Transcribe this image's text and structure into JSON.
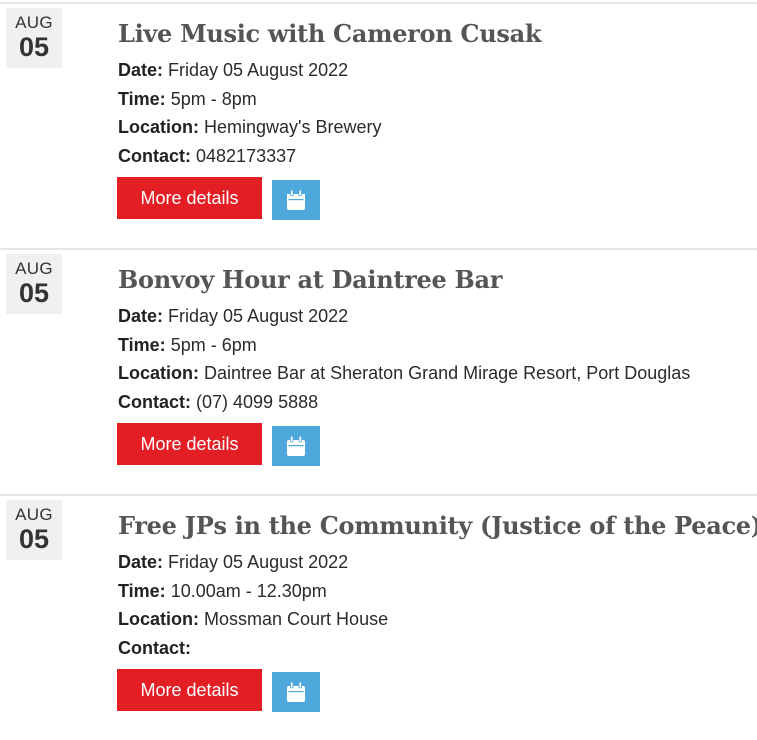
{
  "events": [
    {
      "month": "AUG",
      "day": "05",
      "title": "Live Music with Cameron Cusak",
      "date_label": "Date:",
      "date": "Friday 05 August 2022",
      "time_label": "Time:",
      "time": "5pm - 8pm",
      "location_label": "Location:",
      "location": "Hemingway's Brewery",
      "contact_label": "Contact:",
      "contact": "0482173337",
      "more_label": "More details",
      "calendar_icon": "calendar-icon"
    },
    {
      "month": "AUG",
      "day": "05",
      "title": "Bonvoy Hour at Daintree Bar",
      "date_label": "Date:",
      "date": "Friday 05 August 2022",
      "time_label": "Time:",
      "time": "5pm - 6pm",
      "location_label": "Location:",
      "location": "Daintree Bar at Sheraton Grand Mirage Resort, Port Douglas",
      "contact_label": "Contact:",
      "contact": "(07) 4099 5888",
      "more_label": "More details",
      "calendar_icon": "calendar-icon"
    },
    {
      "month": "AUG",
      "day": "05",
      "title": "Free JPs in the Community (Justice of the Peace)",
      "date_label": "Date:",
      "date": "Friday 05 August 2022",
      "time_label": "Time:",
      "time": "10.00am - 12.30pm",
      "location_label": "Location:",
      "location": "Mossman Court House",
      "contact_label": "Contact:",
      "contact": "",
      "more_label": "More details",
      "calendar_icon": "calendar-icon"
    }
  ],
  "colors": {
    "more_button": "#e31e24",
    "calendar_button": "#4fa8dc",
    "date_badge_bg": "#f0f0f0",
    "title_text": "#555555"
  }
}
